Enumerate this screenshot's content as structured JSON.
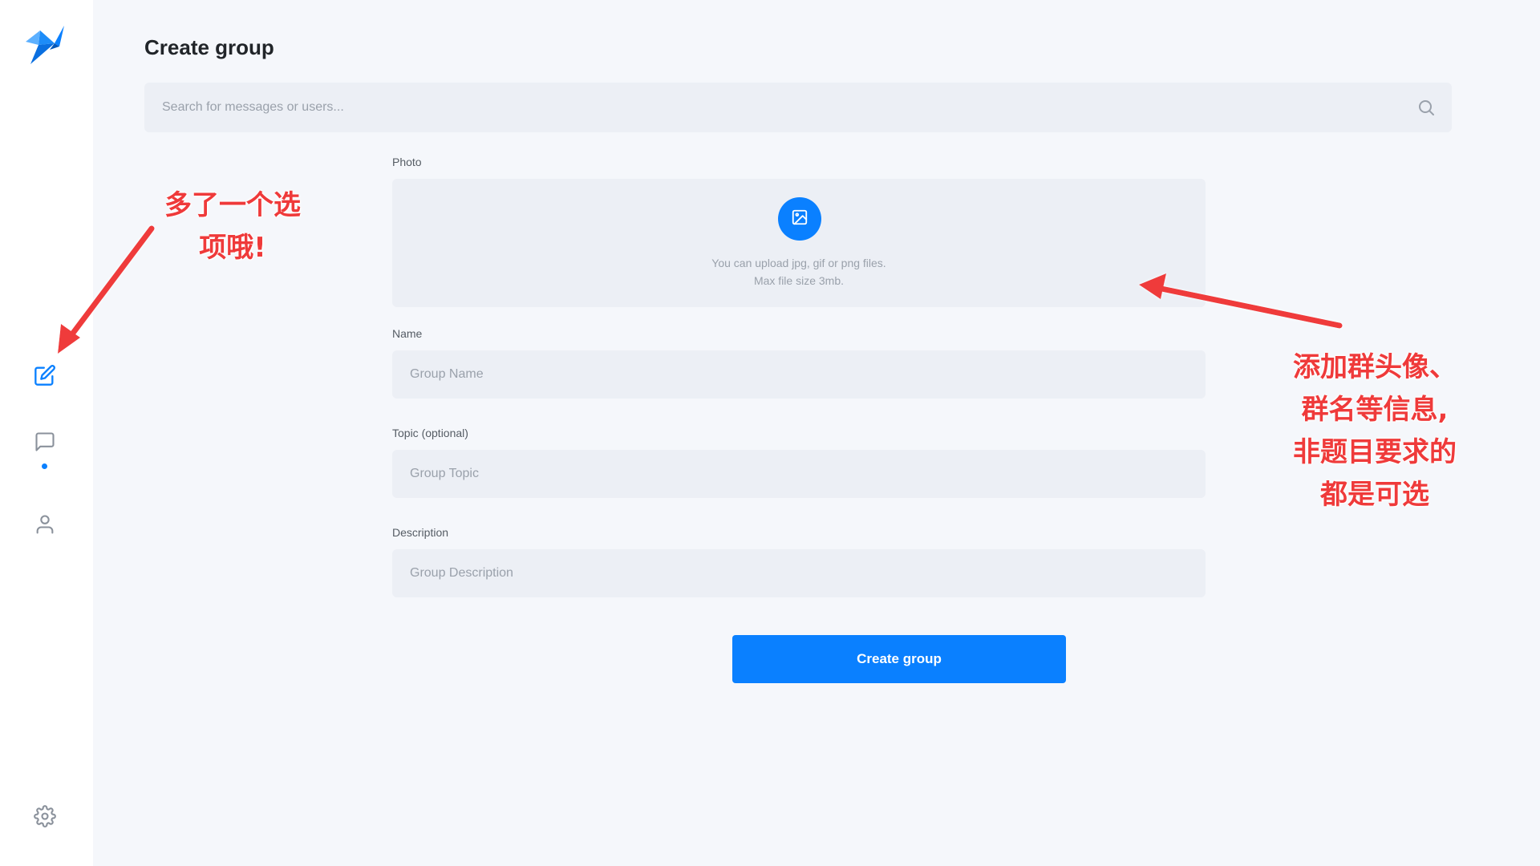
{
  "page": {
    "title": "Create group"
  },
  "search": {
    "placeholder": "Search for messages or users..."
  },
  "sidebar": {
    "items": [
      {
        "name": "compose",
        "icon": "edit-icon",
        "active": true
      },
      {
        "name": "chats",
        "icon": "chat-icon",
        "active": false,
        "has_indicator": true
      },
      {
        "name": "contacts",
        "icon": "user-icon",
        "active": false
      }
    ],
    "settings_icon": "gear-icon"
  },
  "form": {
    "photo": {
      "label": "Photo",
      "hint_line1": "You can upload jpg, gif or png files.",
      "hint_line2": "Max file size 3mb."
    },
    "name": {
      "label": "Name",
      "placeholder": "Group Name"
    },
    "topic": {
      "label": "Topic (optional)",
      "placeholder": "Group Topic"
    },
    "description": {
      "label": "Description",
      "placeholder": "Group Description"
    },
    "submit_label": "Create group"
  },
  "annotations": {
    "left_line1": "多了一个选",
    "left_line2": "项哦!",
    "right_line1": "添加群头像、",
    "right_line2": "群名等信息,",
    "right_line3": "非题目要求的",
    "right_line4": "都是可选"
  },
  "colors": {
    "accent": "#0a80ff",
    "page_background": "#f5f7fb",
    "field_background": "#eceff5",
    "annotation": "#ef3a3a"
  }
}
